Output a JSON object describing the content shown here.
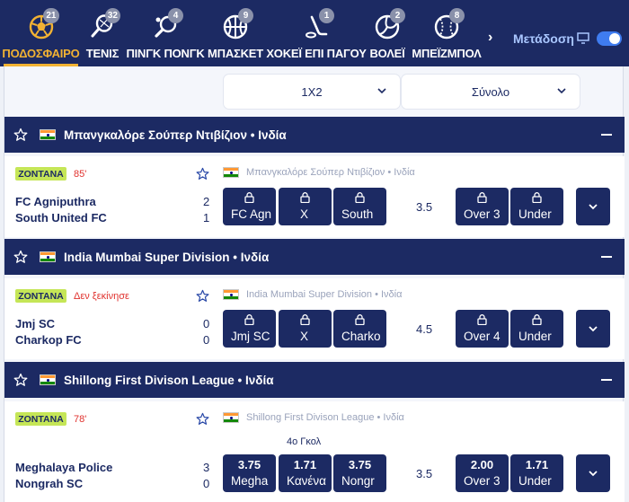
{
  "colors": {
    "navy": "#1c2a63",
    "accent": "#f2b233",
    "live_badge": "#c5e657",
    "minute_red": "#e0322e",
    "toggle_on": "#3f7cf0"
  },
  "nav": {
    "sports": [
      {
        "label": "ΠΟΔΟΣΦΑΙΡΟ",
        "count": "21",
        "icon": "soccer-ball-icon",
        "active": true
      },
      {
        "label": "ΤΕΝΙΣ",
        "count": "32",
        "icon": "tennis-racket-icon"
      },
      {
        "label": "ΠΙΝΓΚ ΠΟΝΓΚ",
        "count": "4",
        "icon": "ping-pong-paddle-icon"
      },
      {
        "label": "ΜΠΑΣΚΕΤ",
        "count": "9",
        "icon": "basketball-icon"
      },
      {
        "label": "ΧΟΚΕΪ ΕΠΙ ΠΑΓΟΥ",
        "count": "1",
        "icon": "hockey-stick-icon"
      },
      {
        "label": "ΒΟΛΕΪ",
        "count": "2",
        "icon": "volleyball-icon"
      },
      {
        "label": "ΜΠΕΪΖΜΠΟΛ",
        "count": "8",
        "icon": "baseball-icon"
      }
    ],
    "more_icon": "chevron-right-icon",
    "live_label": "Μετάδοση",
    "live_toggle_on": true
  },
  "markets": {
    "main": "1X2",
    "secondary": "Σύνολο"
  },
  "leagues": [
    {
      "header": "Μπανγκαλόρε Σούπερ Ντιβίζιον • Ινδία",
      "event": {
        "status": "ΖΟΝΤΑΝΑ",
        "minute": "85'",
        "league_line": "Μπανγκαλόρε Σούπερ Ντιβίζιον • Ινδία",
        "home": "FC Agniputhra",
        "away": "South United FC",
        "home_score": "2",
        "away_score": "1",
        "odds": [
          "FC Agn",
          "X",
          "South"
        ],
        "line": "3.5",
        "total": [
          "Over 3",
          "Under"
        ],
        "locked": true
      }
    },
    {
      "header": "India Mumbai Super Division • Ινδία",
      "event": {
        "status": "ΖΟΝΤΑΝΑ",
        "minute": "Δεν ξεκίνησε",
        "league_line": "India Mumbai Super Division • Ινδία",
        "home": "Jmj SC",
        "away": "Charkop FC",
        "home_score": "0",
        "away_score": "0",
        "odds": [
          "Jmj SC",
          "X",
          "Charko"
        ],
        "line": "4.5",
        "total": [
          "Over 4",
          "Under"
        ],
        "locked": true
      }
    },
    {
      "header": "Shillong First Divison League • Ινδία",
      "event": {
        "status": "ΖΟΝΤΑΝΑ",
        "minute": "78'",
        "league_line": "Shillong First Divison League • Ινδία",
        "goal_label": "4ο Γκολ",
        "home": "Meghalaya Police",
        "away": "Nongrah SC",
        "home_score": "3",
        "away_score": "0",
        "odds": [
          {
            "value": "3.75",
            "label": "Megha"
          },
          {
            "value": "1.71",
            "label": "Κανένα"
          },
          {
            "value": "3.75",
            "label": "Nongr"
          }
        ],
        "line": "3.5",
        "total": [
          {
            "value": "2.00",
            "label": "Over 3"
          },
          {
            "value": "1.71",
            "label": "Under"
          }
        ],
        "locked": false
      }
    }
  ]
}
